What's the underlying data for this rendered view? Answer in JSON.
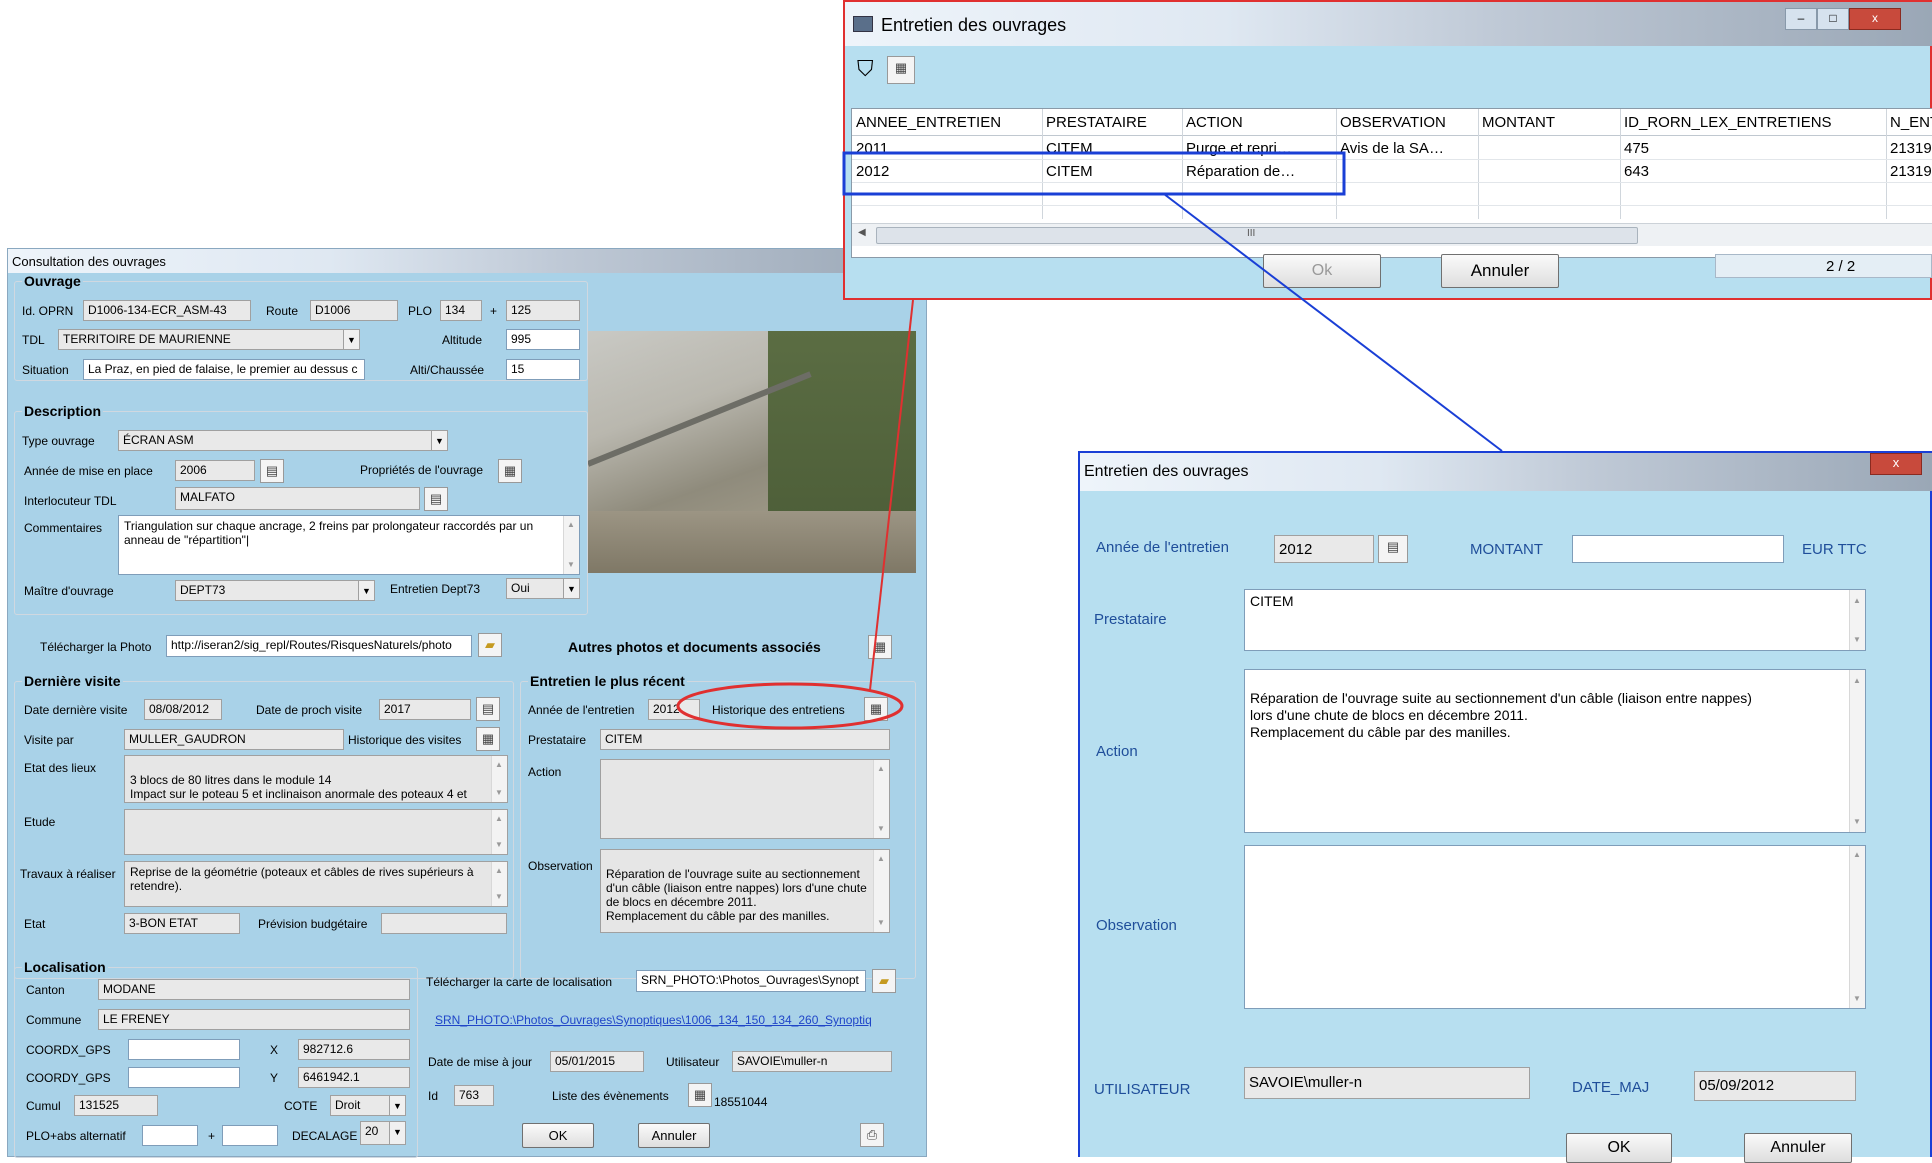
{
  "consultation": {
    "title": "Consultation des ouvrages",
    "ouvrage": {
      "legend": "Ouvrage",
      "id_label": "Id. OPRN",
      "id_value": "D1006-134-ECR_ASM-43",
      "route_label": "Route",
      "route_value": "D1006",
      "plo_label": "PLO",
      "plo_value": "134",
      "plo_plus": "+",
      "plo_abs": "125",
      "tdl_label": "TDL",
      "tdl_value": "TERRITOIRE DE MAURIENNE",
      "altitude_label": "Altitude",
      "altitude_value": "995",
      "situation_label": "Situation",
      "situation_value": "La Praz, en pied de falaise, le premier au dessus c",
      "alti_label": "Alti/Chaussée",
      "alti_value": "15"
    },
    "description": {
      "legend": "Description",
      "type_label": "Type ouvrage",
      "type_value": "ÉCRAN ASM",
      "annee_label": "Année de mise en place",
      "annee_value": "2006",
      "proprietes_label": "Propriétés de l'ouvrage",
      "interlocuteur_label": "Interlocuteur TDL",
      "interlocuteur_value": "MALFATO",
      "commentaires_label": "Commentaires",
      "commentaires_value": "Triangulation sur chaque ancrage, 2 freins par prolongateur raccordés par un anneau de \"répartition\"|",
      "maitre_label": "Maître d'ouvrage",
      "maitre_value": "DEPT73",
      "entretien_dept_label": "Entretien Dept73",
      "entretien_dept_value": "Oui"
    },
    "photo": {
      "telecharger_label": "Télécharger la Photo",
      "url_value": "http://iseran2/sig_repl/Routes/RisquesNaturels/photo",
      "autres_label": "Autres photos et documents associés"
    },
    "derniere_visite": {
      "legend": "Dernière visite",
      "date_label": "Date dernière visite",
      "date_value": "08/08/2012",
      "proch_label": "Date de proch visite",
      "proch_value": "2017",
      "visite_par_label": "Visite par",
      "visite_par_value": "MULLER_GAUDRON",
      "historique_label": "Historique des visites",
      "etat_lieux_label": "Etat des lieux",
      "etat_lieux_value": "3 blocs de 80 litres dans le module 14\nImpact sur le poteau 5 et inclinaison anormale des poteaux 4 et",
      "etude_label": "Etude",
      "etude_value": "",
      "travaux_label": "Travaux à réaliser",
      "travaux_value": "Reprise de la géométrie (poteaux et câbles de rives supérieurs à retendre).",
      "etat_label": "Etat",
      "etat_value": "3-BON ETAT",
      "prevision_label": "Prévision budgétaire",
      "prevision_value": ""
    },
    "entretien_recent": {
      "legend": "Entretien le plus récent",
      "annee_label": "Année de l'entretien",
      "annee_value": "2012",
      "historique_label": "Historique des entretiens",
      "prestataire_label": "Prestataire",
      "prestataire_value": "CITEM",
      "action_label": "Action",
      "action_value": "",
      "observation_label": "Observation",
      "observation_value": "Réparation de l'ouvrage suite au sectionnement d'un câble (liaison entre nappes) lors d'une chute de blocs en décembre 2011.\nRemplacement du câble par des manilles."
    },
    "localisation": {
      "legend": "Localisation",
      "canton_label": "Canton",
      "canton_value": "MODANE",
      "commune_label": "Commune",
      "commune_value": "LE FRENEY",
      "coordx_label": "COORDX_GPS",
      "coordx_value": "",
      "x_label": "X",
      "x_value": "982712.6",
      "coordy_label": "COORDY_GPS",
      "coordy_value": "",
      "y_label": "Y",
      "y_value": "6461942.1",
      "cumul_label": "Cumul",
      "cumul_value": "131525",
      "cote_label": "COTE",
      "cote_value": "Droit",
      "plo_alt_label": "PLO+abs alternatif",
      "plo_alt_plus": "+",
      "decalage_label": "DECALAGE",
      "decalage_value": "20",
      "carte_label": "Télécharger la carte de localisation",
      "carte_value": "SRN_PHOTO:\\Photos_Ouvrages\\Synopt",
      "carte_link": "SRN_PHOTO:\\Photos_Ouvrages\\Synoptiques\\1006_134_150_134_260_Synoptiq",
      "date_maj_label": "Date de mise à jour",
      "date_maj_value": "05/01/2015",
      "utilisateur_label": "Utilisateur",
      "utilisateur_value": "SAVOIE\\muller-n",
      "id_label": "Id",
      "id_value": "763",
      "evenements_label": "Liste des évènements",
      "evenements_value": "18551044"
    },
    "ok_label": "OK",
    "annuler_label": "Annuler"
  },
  "grid_window": {
    "title": "Entretien des ouvrages",
    "columns": [
      "ANNEE_ENTRETIEN",
      "PRESTATAIRE",
      "ACTION",
      "OBSERVATION",
      "MONTANT",
      "ID_RORN_LEX_ENTRETIENS",
      "N_ENT"
    ],
    "rows": [
      [
        "2011",
        "CITEM",
        "Purge et repri…",
        "Avis de la SA…",
        "",
        "475",
        "21319"
      ],
      [
        "2012",
        "CITEM",
        "Réparation de…",
        "",
        "",
        "643",
        "21319"
      ]
    ],
    "scroll_mark": "III",
    "ok_label": "Ok",
    "annuler_label": "Annuler",
    "counter": "2 / 2"
  },
  "detail_window": {
    "title": "Entretien des ouvrages",
    "annee_label": "Année de l'entretien",
    "annee_value": "2012",
    "montant_label": "MONTANT",
    "montant_value": "",
    "montant_unit": "EUR TTC",
    "prestataire_label": "Prestataire",
    "prestataire_value": "CITEM",
    "action_label": "Action",
    "action_value": "Réparation de l'ouvrage suite au sectionnement d'un câble (liaison entre nappes)\nlors d'une chute de blocs en décembre 2011.\nRemplacement du câble par des manilles.",
    "observation_label": "Observation",
    "observation_value": "",
    "utilisateur_label": "UTILISATEUR",
    "utilisateur_value": "SAVOIE\\muller-n",
    "date_maj_label": "DATE_MAJ",
    "date_maj_value": "05/09/2012",
    "ok_label": "OK",
    "annuler_label": "Annuler"
  },
  "colors": {
    "form_bg": "#a9d2e8",
    "dialog_bg": "#b7dff0",
    "annotation_red": "#e03030",
    "annotation_blue": "#1a3fd6"
  }
}
